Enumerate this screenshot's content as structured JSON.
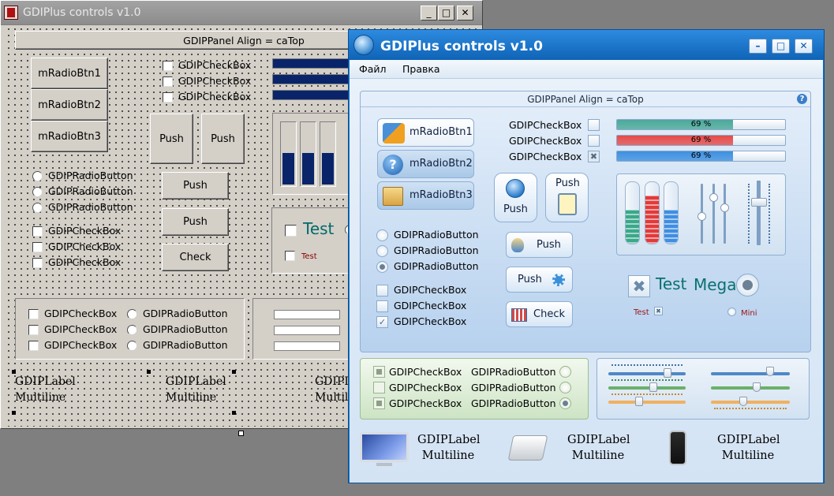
{
  "back_window": {
    "title": "GDIPlus controls v1.0",
    "controls": {
      "minimize": "_",
      "maximize": "□",
      "close": "✕"
    },
    "panel_caption": "GDIPPanel Align = caTop",
    "radio_buttons": [
      "mRadioBtn1",
      "mRadioBtn2",
      "mRadioBtn3"
    ],
    "checkboxes": [
      "GDIPCheckBox",
      "GDIPCheckBox",
      "GDIPCheckBox"
    ],
    "push_buttons": [
      "Push",
      "Push",
      "Push",
      "Push"
    ],
    "check_button": "Check",
    "radios": [
      "GDIPRadioButton",
      "GDIPRadioButton",
      "GDIPRadioButton"
    ],
    "checkboxes2": [
      "GDIPCheckBox",
      "GDIPCheckBox",
      "GDIPCheckBox"
    ],
    "test_big": "Test",
    "test_small": "Test",
    "lower_checkboxes": [
      "GDIPCheckBox",
      "GDIPCheckBox",
      "GDIPCheckBox"
    ],
    "lower_radios": [
      "GDIPRadioButton",
      "GDIPRadioButton",
      "GDIPRadioButton"
    ],
    "labels": [
      {
        "line1": "GDIPLabel",
        "line2": "Multiline"
      },
      {
        "line1": "GDIPLabel",
        "line2": "Multiline"
      },
      {
        "line1": "GDIPLabel",
        "line2": "Multiline"
      }
    ]
  },
  "front_window": {
    "title": "GDIPlus controls v1.0",
    "controls": {
      "minimize": "–",
      "maximize": "□",
      "close": "✕"
    },
    "menu": [
      "Файл",
      "Правка"
    ],
    "panel_caption": "GDIPPanel Align = caTop",
    "help": "?",
    "radio_buttons": [
      "mRadioBtn1",
      "mRadioBtn2",
      "mRadioBtn3"
    ],
    "checkboxes": [
      {
        "label": "GDIPCheckBox",
        "mark": ""
      },
      {
        "label": "GDIPCheckBox",
        "mark": ""
      },
      {
        "label": "GDIPCheckBox",
        "mark": "✖"
      }
    ],
    "progress": [
      {
        "text": "69 %",
        "value": 69,
        "color": "#4aa89a"
      },
      {
        "text": "69 %",
        "value": 69,
        "color": "#e44b4b"
      },
      {
        "text": "69 %",
        "value": 69,
        "color": "#3d8fe0"
      }
    ],
    "icon_buttons": [
      "Push",
      "Push"
    ],
    "push_buttons": [
      "Push",
      "Push"
    ],
    "check_button": "Check",
    "radios": [
      {
        "label": "GDIPRadioButton",
        "checked": false
      },
      {
        "label": "GDIPRadioButton",
        "checked": false
      },
      {
        "label": "GDIPRadioButton",
        "checked": true
      }
    ],
    "checkboxes2": [
      {
        "label": "GDIPCheckBox",
        "mark": ""
      },
      {
        "label": "GDIPCheckBox",
        "mark": ""
      },
      {
        "label": "GDIPCheckBox",
        "mark": "✓"
      }
    ],
    "test_big": "Test",
    "mega": "Mega",
    "test_small": "Test",
    "mini": "Mini",
    "tubes": [
      {
        "value": 0.55,
        "color": "#3aa88a"
      },
      {
        "value": 0.78,
        "color": "#e23a3a"
      },
      {
        "value": 0.55,
        "color": "#3f8ee2"
      }
    ],
    "green_panel": {
      "checkboxes": [
        "GDIPCheckBox",
        "GDIPCheckBox",
        "GDIPCheckBox"
      ],
      "radios": [
        "GDIPRadioButton",
        "GDIPRadioButton",
        "GDIPRadioButton"
      ]
    },
    "labels": [
      {
        "line1": "GDIPLabel",
        "line2": "Multiline"
      },
      {
        "line1": "GDIPLabel",
        "line2": "Multiline"
      },
      {
        "line1": "GDIPLabel",
        "line2": "Multiline"
      }
    ]
  }
}
